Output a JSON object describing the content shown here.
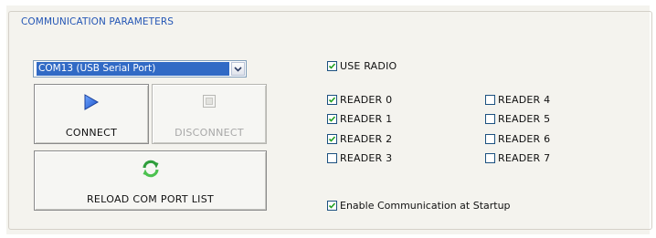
{
  "group": {
    "title": "COMMUNICATION PARAMETERS"
  },
  "port_select": {
    "value": "COM13 (USB Serial Port)",
    "icon": "chevron-down-icon"
  },
  "buttons": {
    "connect": {
      "label": "CONNECT",
      "icon": "play-icon",
      "enabled": true
    },
    "disconnect": {
      "label": "DISCONNECT",
      "icon": "stop-icon",
      "enabled": false
    },
    "reload": {
      "label": "RELOAD COM PORT LIST",
      "icon": "refresh-icon",
      "enabled": true
    }
  },
  "use_radio": {
    "label": "USE RADIO",
    "checked": true
  },
  "readers": [
    {
      "label": "READER 0",
      "checked": true
    },
    {
      "label": "READER 1",
      "checked": true
    },
    {
      "label": "READER 2",
      "checked": true
    },
    {
      "label": "READER 3",
      "checked": false
    },
    {
      "label": "READER 4",
      "checked": false
    },
    {
      "label": "READER 5",
      "checked": false
    },
    {
      "label": "READER 6",
      "checked": false
    },
    {
      "label": "READER 7",
      "checked": false
    }
  ],
  "startup": {
    "label": "Enable Communication at Startup",
    "checked": true
  },
  "colors": {
    "group_title": "#2456b5",
    "selection": "#316ac5",
    "checkmark": "#21a121",
    "play": "#2e6fe0",
    "refresh": "#3bb24a"
  }
}
